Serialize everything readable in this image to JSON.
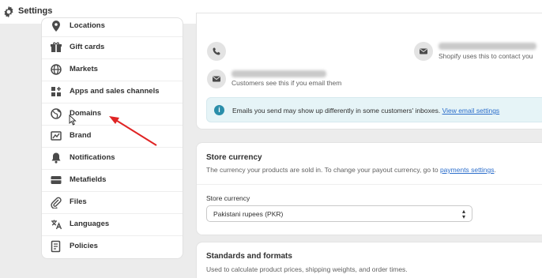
{
  "topbar": {
    "title": "Settings",
    "icon": "gear-icon"
  },
  "sidebar": {
    "items": [
      {
        "label": "Locations",
        "icon": "location-pin-icon"
      },
      {
        "label": "Gift cards",
        "icon": "gift-icon"
      },
      {
        "label": "Markets",
        "icon": "globe-icon"
      },
      {
        "label": "Apps and sales channels",
        "icon": "apps-icon"
      },
      {
        "label": "Domains",
        "icon": "globe-icon"
      },
      {
        "label": "Brand",
        "icon": "brand-icon"
      },
      {
        "label": "Notifications",
        "icon": "bell-icon"
      },
      {
        "label": "Metafields",
        "icon": "metafields-icon"
      },
      {
        "label": "Files",
        "icon": "paperclip-icon"
      },
      {
        "label": "Languages",
        "icon": "language-icon"
      },
      {
        "label": "Policies",
        "icon": "policy-icon"
      }
    ]
  },
  "contact": {
    "sender_helper": "Shopify uses this to contact you",
    "customer_helper": "Customers see this if you email them",
    "banner_text": "Emails you send may show up differently in some customers' inboxes.",
    "banner_link": "View email settings"
  },
  "currency": {
    "title": "Store currency",
    "description": "The currency your products are sold in. To change your payout currency, go to",
    "description_link": "payments settings",
    "description_end": ".",
    "field_label": "Store currency",
    "selected": "Pakistani rupees (PKR)"
  },
  "standards": {
    "title": "Standards and formats",
    "description": "Used to calculate product prices, shipping weights, and order times."
  },
  "colors": {
    "accent_link": "#2c6ecb",
    "annotation_arrow": "#e02424",
    "info_blue": "#2a8eaa"
  }
}
